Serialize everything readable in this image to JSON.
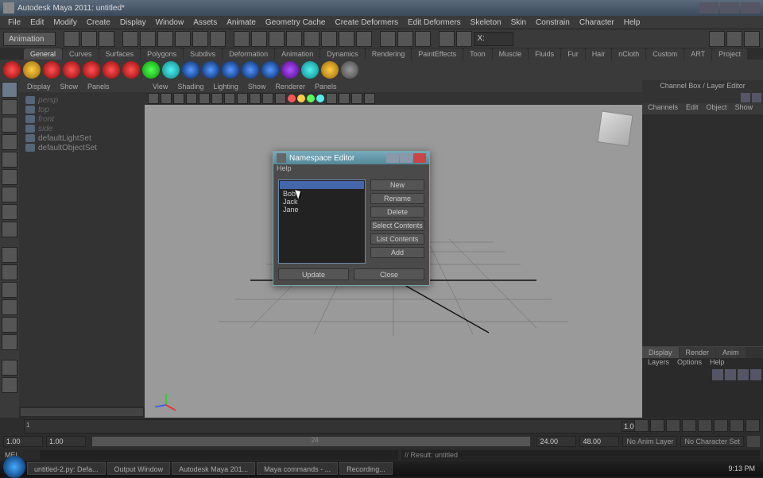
{
  "title": "Autodesk Maya 2011: untitled*",
  "menus": [
    "File",
    "Edit",
    "Modify",
    "Create",
    "Display",
    "Window",
    "Assets",
    "Animate",
    "Geometry Cache",
    "Create Deformers",
    "Edit Deformers",
    "Skeleton",
    "Skin",
    "Constrain",
    "Character",
    "Help"
  ],
  "mode_dropdown": "Animation",
  "shelf_tabs": [
    "General",
    "Curves",
    "Surfaces",
    "Polygons",
    "Subdivs",
    "Deformation",
    "Animation",
    "Dynamics",
    "Rendering",
    "PaintEffects",
    "Toon",
    "Muscle",
    "Fluids",
    "Fur",
    "Hair",
    "nCloth",
    "Custom",
    "ART",
    "Project"
  ],
  "shelf_active": 0,
  "outliner_menu": [
    "Display",
    "Show",
    "Panels"
  ],
  "outliner_items": [
    {
      "label": "persp",
      "dim": true
    },
    {
      "label": "top",
      "dim": true
    },
    {
      "label": "front",
      "dim": true
    },
    {
      "label": "side",
      "dim": true
    },
    {
      "label": "defaultLightSet",
      "dim": false
    },
    {
      "label": "defaultObjectSet",
      "dim": false
    }
  ],
  "viewport_menu": [
    "View",
    "Shading",
    "Lighting",
    "Show",
    "Renderer",
    "Panels"
  ],
  "channelbox_title": "Channel Box / Layer Editor",
  "channelbox_menu": [
    "Channels",
    "Edit",
    "Object",
    "Show"
  ],
  "layer_tabs": [
    "Display",
    "Render",
    "Anim"
  ],
  "layer_menu": [
    "Layers",
    "Options",
    "Help"
  ],
  "timeline": {
    "start": "1.00",
    "end": "48.00",
    "range_start": "1.00",
    "range_end": "24.00",
    "current": "1",
    "mid_label": "24"
  },
  "no_anim_layer": "No Anim Layer",
  "no_char_set": "No Character Set",
  "cmd_label": "MEL",
  "result": "// Result: untitled",
  "taskbar": [
    "untitled-2.py: Defa...",
    "Output Window",
    "Autodesk Maya 201...",
    "Maya commands - ...",
    "Recording..."
  ],
  "clock": "9:13 PM",
  "dialog": {
    "title": "Namespace Editor",
    "menu": "Help",
    "items": [
      "",
      "Bob",
      "Jack",
      "Jane"
    ],
    "selected": 0,
    "buttons": [
      "New",
      "Rename",
      "Delete",
      "Select Contents",
      "List Contents",
      "Add"
    ],
    "bottom": [
      "Update",
      "Close"
    ]
  }
}
